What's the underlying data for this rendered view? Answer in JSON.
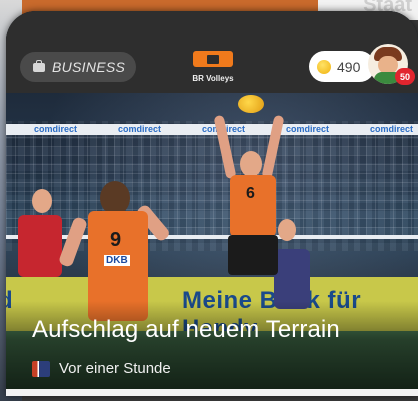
{
  "background_page": {
    "partial_text": "Staat"
  },
  "header": {
    "category_label": "BUSINESS",
    "team_name": "BR Volleys",
    "coin_count": "490",
    "notification_count": "50"
  },
  "photo": {
    "net_sponsor": "comdirect",
    "banner_text": "Meine Bank für Handy",
    "banner_text_left": "d",
    "jersey_numbers": [
      "9",
      "6"
    ],
    "jersey_sponsor": "DKB"
  },
  "article": {
    "headline": "Aufschlag auf neuem Terrain",
    "timestamp": "Vor einer Stunde"
  },
  "colors": {
    "accent": "#f07a1c",
    "badge": "#e2252e",
    "jersey": "#e8712a"
  },
  "icons": [
    "briefcase-icon",
    "team-logo",
    "coin-icon",
    "avatar-icon",
    "source-icon"
  ]
}
